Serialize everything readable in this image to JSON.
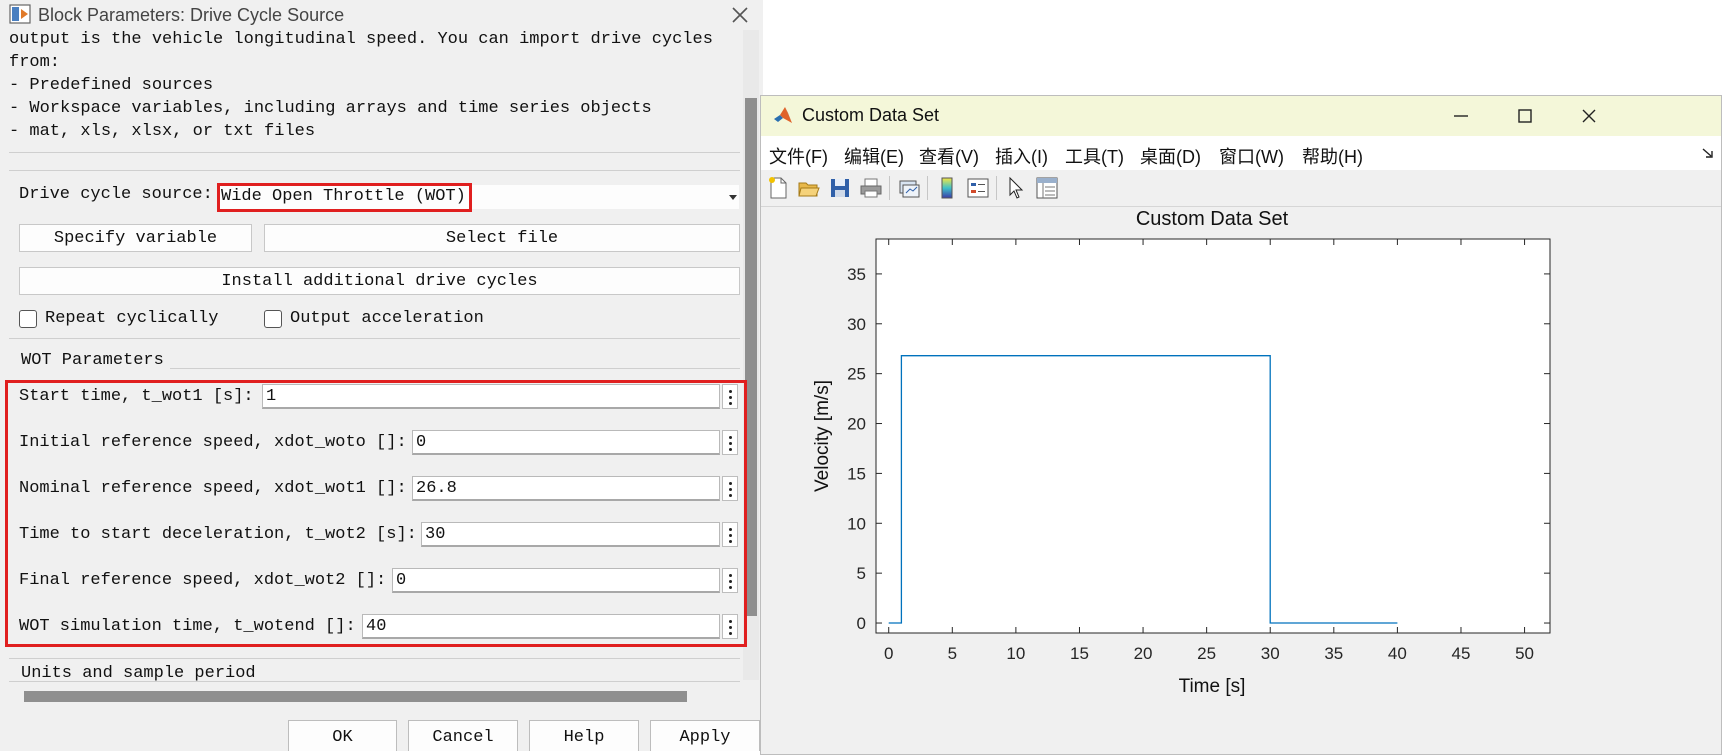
{
  "dialog": {
    "title": "Block Parameters: Drive Cycle Source",
    "description": [
      "output is the vehicle longitudinal speed. You can import drive cycles",
      "from:",
      "- Predefined sources",
      "- Workspace variables, including arrays and time series objects",
      "- mat, xls, xlsx, or txt files"
    ],
    "source_label": "Drive cycle source:",
    "source_value": "Wide Open Throttle (WOT)",
    "specify_variable": "Specify variable",
    "select_file": "Select file",
    "install_cycles": "Install additional drive cycles",
    "repeat_cyclically": "Repeat cyclically",
    "output_acceleration": "Output acceleration",
    "wot_section": "WOT Parameters",
    "params": [
      {
        "label": "Start time, t_wot1 [s]:",
        "value": "1"
      },
      {
        "label": "Initial reference speed, xdot_woto []:",
        "value": "0"
      },
      {
        "label": "Nominal reference speed, xdot_wot1 []:",
        "value": "26.8"
      },
      {
        "label": "Time to start deceleration, t_wot2 [s]:",
        "value": "30"
      },
      {
        "label": "Final reference speed, xdot_wot2 []:",
        "value": "0"
      },
      {
        "label": "WOT simulation time, t_wotend []:",
        "value": "40"
      }
    ],
    "units_section": "Units and sample period",
    "buttons": {
      "ok": "OK",
      "cancel": "Cancel",
      "help": "Help",
      "apply": "Apply"
    },
    "highlight_color": "#e01f1f"
  },
  "figure": {
    "window_title": "Custom Data Set",
    "menus": [
      "文件(F)",
      "编辑(E)",
      "查看(V)",
      "插入(I)",
      "工具(T)",
      "桌面(D)",
      "窗口(W)",
      "帮助(H)"
    ],
    "toolbar_icons": [
      "new-figure-icon",
      "open-icon",
      "save-icon",
      "print-icon",
      "link-plot-icon",
      "colorbar-icon",
      "legend-icon",
      "pointer-icon",
      "property-inspector-icon"
    ]
  },
  "chart_data": {
    "type": "line",
    "title": "Custom Data Set",
    "xlabel": "Time [s]",
    "ylabel": "Velocity [m/s]",
    "xlim": [
      -1,
      52
    ],
    "ylim": [
      -1,
      38.5
    ],
    "xticks": [
      0,
      5,
      10,
      15,
      20,
      25,
      30,
      35,
      40,
      45,
      50
    ],
    "yticks": [
      0,
      5,
      10,
      15,
      20,
      25,
      30,
      35
    ],
    "grid": false,
    "color": "#0072bd",
    "series": [
      {
        "x": [
          0,
          1,
          1,
          30,
          30,
          40
        ],
        "y": [
          0,
          0,
          26.8,
          26.8,
          0,
          0
        ]
      }
    ]
  }
}
